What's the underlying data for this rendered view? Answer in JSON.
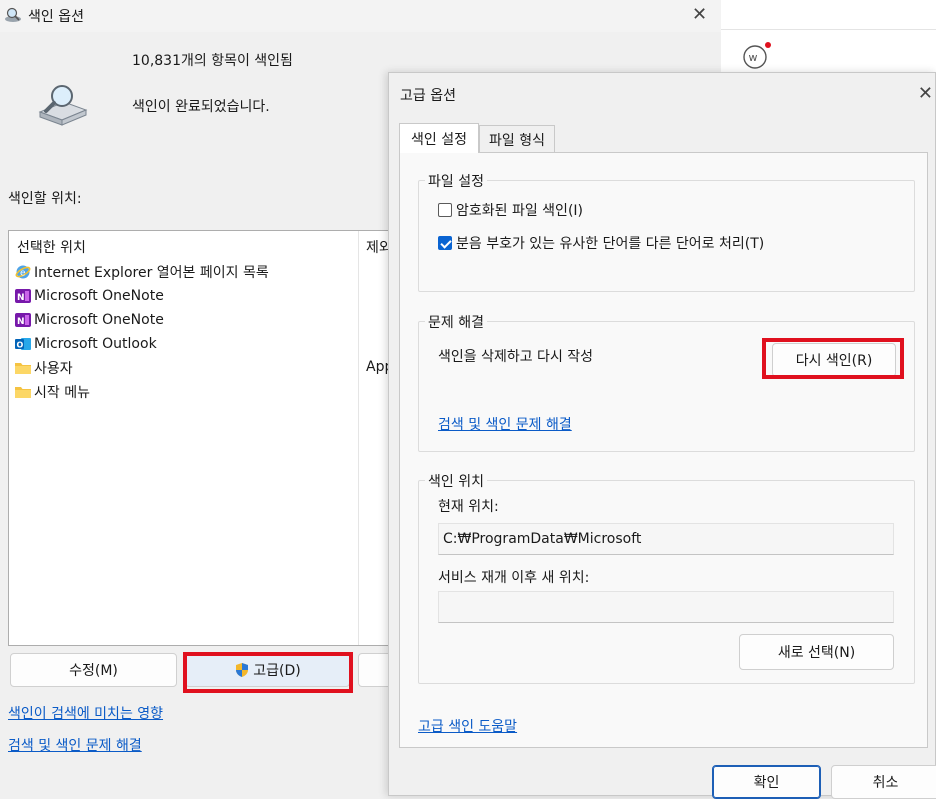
{
  "main_window": {
    "title": "색인 옵션",
    "indexed_count": "10,831개의 항목이 색인됨",
    "status": "색인이 완료되었습니다.",
    "locations_heading": "색인할 위치:",
    "columns": [
      "선택한 위치",
      "제외"
    ],
    "locations": [
      {
        "icon": "internet-explorer-icon",
        "label": "Internet Explorer 열어본 페이지 목록"
      },
      {
        "icon": "onenote-icon",
        "label": "Microsoft OneNote"
      },
      {
        "icon": "onenote-icon",
        "label": "Microsoft OneNote"
      },
      {
        "icon": "outlook-icon",
        "label": "Microsoft Outlook"
      },
      {
        "icon": "folder-icon",
        "label": "사용자"
      },
      {
        "icon": "folder-icon",
        "label": "시작 메뉴"
      }
    ],
    "exclude_value_user": "App",
    "buttons": {
      "modify": "수정(M)",
      "advanced": "고급(D)"
    },
    "links": [
      "색인이 검색에 미치는 영향",
      "검색 및 색인 문제 해결"
    ]
  },
  "advanced_dialog": {
    "title": "고급 옵션",
    "tabs": [
      "색인 설정",
      "파일 형식"
    ],
    "file_settings": {
      "label": "파일 설정",
      "encrypt_label": "암호화된 파일 색인(I)",
      "encrypt_checked": false,
      "diacritics_label": "분음 부호가 있는 유사한 단어를 다른 단어로 처리(T)",
      "diacritics_checked": true
    },
    "troubleshoot": {
      "label": "문제 해결",
      "rebuild_text": "색인을 삭제하고 다시 작성",
      "rebuild_button": "다시 색인(R)",
      "link": "검색 및 색인 문제 해결"
    },
    "index_location": {
      "label": "색인 위치",
      "current_label": "현재 위치:",
      "current_value": "C:₩ProgramData₩Microsoft",
      "new_label": "서비스 재개 이후 새 위치:",
      "new_value": "",
      "select_new_button": "새로 선택(N)"
    },
    "help_link": "고급 색인 도움말",
    "ok_button": "확인",
    "cancel_button": "취소"
  },
  "highlight_color": "#e0101e",
  "accent_color": "#0a64d2"
}
